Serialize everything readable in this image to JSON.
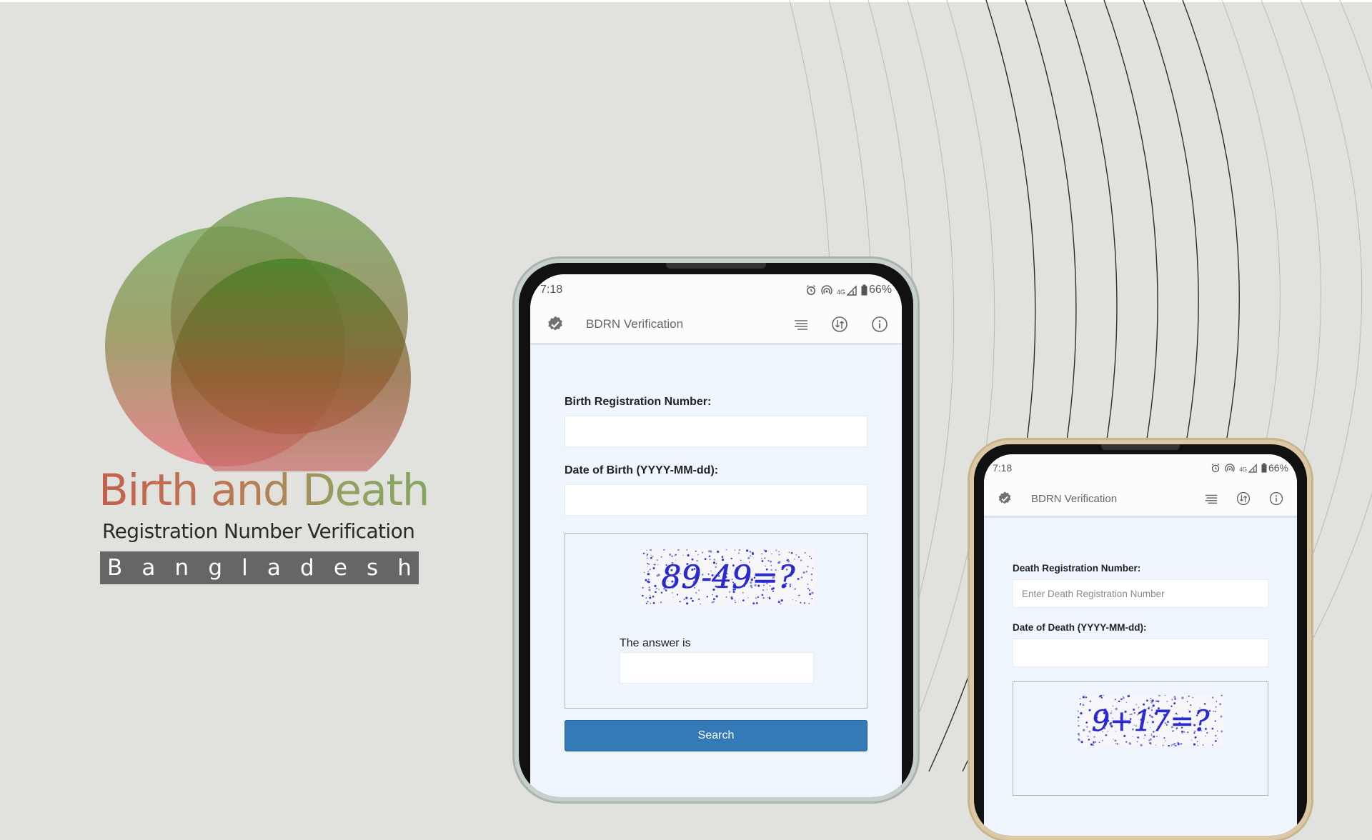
{
  "logo": {
    "title": "Birth and Death",
    "subtitle": "Registration Number Verification",
    "country_letters": [
      "B",
      "a",
      "n",
      "g",
      "l",
      "a",
      "d",
      "e",
      "s",
      "h"
    ]
  },
  "colors": {
    "background": "#e1e2dd",
    "primary_button": "#337ab7",
    "screen_background": "#eef5fc",
    "logo_green": "#4b8a2a",
    "logo_red": "#d9534f",
    "logo_bar": "#666666"
  },
  "phone_birth": {
    "status": {
      "time": "7:18",
      "network": "4G",
      "battery": "66%",
      "icons": [
        "alarm-icon",
        "hotspot-icon",
        "signal-icon",
        "battery-icon"
      ]
    },
    "app_bar": {
      "title": "BDRN Verification",
      "icons": [
        "verified-badge-icon",
        "menu-lines-icon",
        "history-icon",
        "info-icon"
      ]
    },
    "form": {
      "reg_label": "Birth Registration Number:",
      "reg_value": "",
      "dob_label": "Date of Birth (YYYY-MM-dd):",
      "dob_value": "",
      "captcha_text": "89-49=?",
      "answer_label": "The answer is",
      "answer_value": "",
      "search_label": "Search"
    }
  },
  "phone_death": {
    "status": {
      "time": "7:18",
      "network": "4G",
      "battery": "66%",
      "icons": [
        "alarm-icon",
        "hotspot-icon",
        "signal-icon",
        "battery-icon"
      ]
    },
    "app_bar": {
      "title": "BDRN Verification",
      "icons": [
        "verified-badge-icon",
        "menu-lines-icon",
        "history-icon",
        "info-icon"
      ]
    },
    "form": {
      "reg_label": "Death Registration Number:",
      "reg_placeholder": "Enter Death Registration Number",
      "dod_label": "Date of Death (YYYY-MM-dd):",
      "dod_value": "",
      "captcha_text": "9+17=?"
    }
  }
}
